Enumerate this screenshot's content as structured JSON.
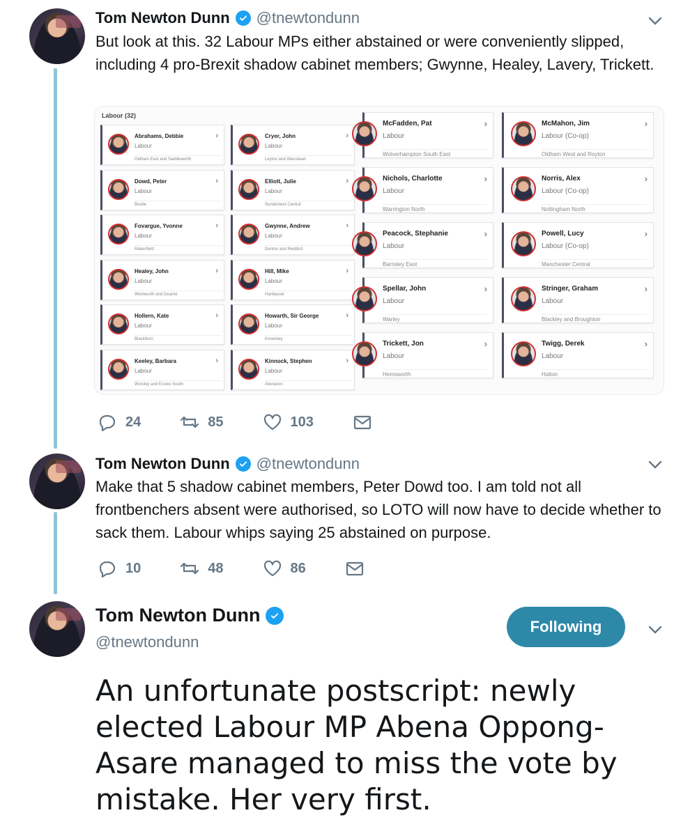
{
  "tweets": [
    {
      "name": "Tom Newton Dunn",
      "handle": "@tnewtondunn",
      "text": "But look at this. 32 Labour MPs either abstained or were conveniently slipped, including 4 pro-Brexit shadow cabinet members; Gwynne, Healey, Lavery, Trickett.",
      "replies": "24",
      "retweets": "85",
      "likes": "103"
    },
    {
      "name": "Tom Newton Dunn",
      "handle": "@tnewtondunn",
      "text": "Make that 5 shadow cabinet members, Peter Dowd too. I am told not all frontbenchers absent were authorised, so LOTO will now have to decide whether to sack them. Labour whips saying 25 abstained on purpose.",
      "replies": "10",
      "retweets": "48",
      "likes": "86"
    },
    {
      "name": "Tom Newton Dunn",
      "handle": "@tnewtondunn",
      "follow_label": "Following",
      "text": "An unfortunate postscript: newly elected Labour MP Abena Oppong-Asare managed to miss the vote by mistake. Her very first."
    }
  ],
  "media": {
    "title": "Labour (32)",
    "col1": [
      {
        "name": "Abrahams, Debbie",
        "party": "Labour",
        "seat": "Oldham East and Saddleworth"
      },
      {
        "name": "Dowd, Peter",
        "party": "Labour",
        "seat": "Bootle"
      },
      {
        "name": "Fovargue, Yvonne",
        "party": "Labour",
        "seat": "Makerfield"
      },
      {
        "name": "Healey, John",
        "party": "Labour",
        "seat": "Wentworth and Dearne"
      },
      {
        "name": "Hollern, Kate",
        "party": "Labour",
        "seat": "Blackburn"
      },
      {
        "name": "Keeley, Barbara",
        "party": "Labour",
        "seat": "Worsley and Eccles South"
      }
    ],
    "col2": [
      {
        "name": "Cryer, John",
        "party": "Labour",
        "seat": "Leyton and Wanstead"
      },
      {
        "name": "Elliott, Julie",
        "party": "Labour",
        "seat": "Sunderland Central"
      },
      {
        "name": "Gwynne, Andrew",
        "party": "Labour",
        "seat": "Denton and Reddish"
      },
      {
        "name": "Hill, Mike",
        "party": "Labour",
        "seat": "Hartlepool"
      },
      {
        "name": "Howarth, Sir George",
        "party": "Labour",
        "seat": "Knowsley"
      },
      {
        "name": "Kinnock, Stephen",
        "party": "Labour",
        "seat": "Aberavon"
      }
    ],
    "col3": [
      {
        "name": "McFadden, Pat",
        "party": "Labour",
        "seat": "Wolverhampton South East"
      },
      {
        "name": "Nichols, Charlotte",
        "party": "Labour",
        "seat": "Warrington North"
      },
      {
        "name": "Peacock, Stephanie",
        "party": "Labour",
        "seat": "Barnsley East"
      },
      {
        "name": "Spellar, John",
        "party": "Labour",
        "seat": "Warley"
      },
      {
        "name": "Trickett, Jon",
        "party": "Labour",
        "seat": "Hemsworth"
      }
    ],
    "col4": [
      {
        "name": "McMahon, Jim",
        "party": "Labour (Co-op)",
        "seat": "Oldham West and Royton"
      },
      {
        "name": "Norris, Alex",
        "party": "Labour (Co-op)",
        "seat": "Nottingham North"
      },
      {
        "name": "Powell, Lucy",
        "party": "Labour (Co-op)",
        "seat": "Manchester Central"
      },
      {
        "name": "Stringer, Graham",
        "party": "Labour",
        "seat": "Blackley and Broughton"
      },
      {
        "name": "Twigg, Derek",
        "party": "Labour",
        "seat": "Halton"
      }
    ]
  },
  "icons": [
    "verified-icon",
    "chevron-down-icon",
    "reply-icon",
    "retweet-icon",
    "like-icon",
    "message-icon"
  ],
  "colors": {
    "thread_line": "#8ec5d6",
    "follow_button": "#2e88a8",
    "verified": "#1da1f2",
    "muted": "#657786"
  }
}
